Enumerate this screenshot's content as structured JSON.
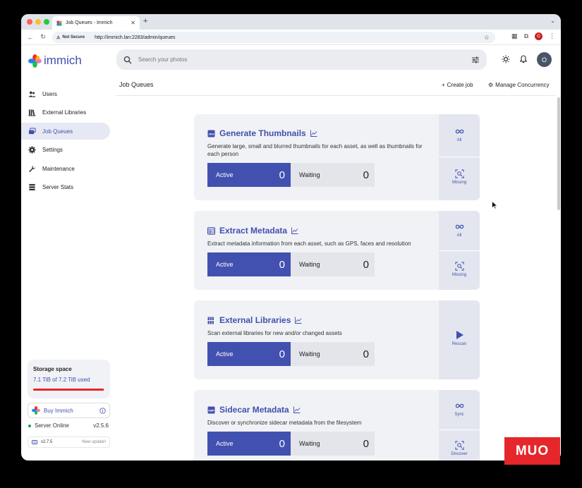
{
  "browser": {
    "tab_title": "Job Queues - Immich",
    "new_tab": "+",
    "security_label": "Not Secure",
    "url": "http://immich.lan:2283/admin/queues",
    "profile_initial": "O"
  },
  "header": {
    "brand": "immich",
    "search_placeholder": "Search your photos",
    "avatar_initial": "O"
  },
  "sidebar": {
    "items": [
      {
        "label": "Users",
        "icon": "users-icon"
      },
      {
        "label": "External Libraries",
        "icon": "library-icon"
      },
      {
        "label": "Job Queues",
        "icon": "queue-icon",
        "active": true
      },
      {
        "label": "Settings",
        "icon": "gear-icon"
      },
      {
        "label": "Maintenance",
        "icon": "wrench-icon"
      },
      {
        "label": "Server Stats",
        "icon": "server-icon"
      }
    ],
    "storage": {
      "title": "Storage space",
      "used": "7.1 TiB of 7.2 TiB used",
      "fill_fraction": 0.986
    },
    "buy_label": "Buy Immich",
    "server_status": "Server Online",
    "server_version": "v2.5.6",
    "update_version": "v2.7.5",
    "update_label": "New update!"
  },
  "page": {
    "title": "Job Queues",
    "create_job": "Create job",
    "manage_concurrency": "Manage Concurrency"
  },
  "labels": {
    "active": "Active",
    "waiting": "Waiting"
  },
  "jobs": [
    {
      "title": "Generate Thumbnails",
      "description": "Generate large, small and blurred thumbnails for each asset, as well as thumbnails for each person",
      "active": "0",
      "waiting": "0",
      "actions": [
        "All",
        "Missing"
      ]
    },
    {
      "title": "Extract Metadata",
      "description": "Extract metadata information from each asset, such as GPS, faces and resolution",
      "active": "0",
      "waiting": "0",
      "actions": [
        "All",
        "Missing"
      ]
    },
    {
      "title": "External Libraries",
      "description": "Scan external libraries for new and/or changed assets",
      "active": "0",
      "waiting": "0",
      "actions": [
        "Rescan"
      ]
    },
    {
      "title": "Sidecar Metadata",
      "description": "Discover or synchronize sidecar metadata from the filesystem",
      "active": "0",
      "waiting": "0",
      "actions": [
        "Sync",
        "Discover"
      ]
    }
  ],
  "watermark": "MUO",
  "colors": {
    "accent": "#4250af",
    "danger": "#e5262a",
    "online": "#16a34a"
  }
}
